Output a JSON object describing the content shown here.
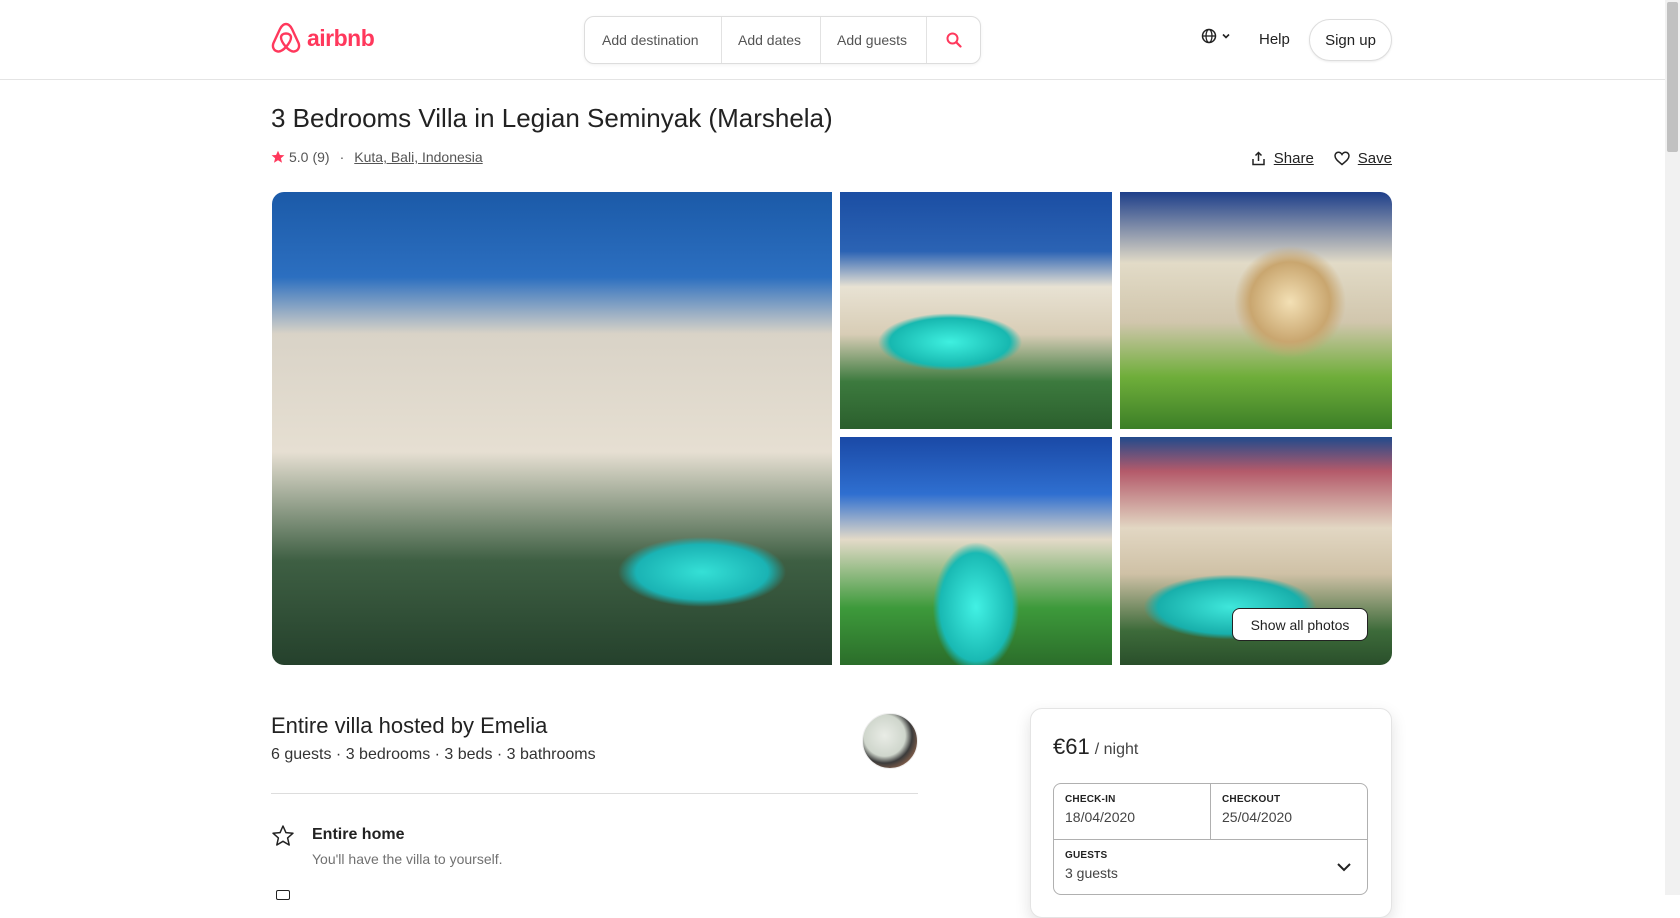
{
  "brand": {
    "name": "airbnb",
    "color": "#ff385c"
  },
  "search": {
    "destination_placeholder": "Add destination",
    "dates_placeholder": "Add dates",
    "guests_placeholder": "Add guests"
  },
  "nav": {
    "language_icon": "globe-icon",
    "help_label": "Help",
    "signup_label": "Sign up"
  },
  "listing": {
    "title": "3 Bedrooms Villa in Legian Seminyak (Marshela)",
    "rating": "5.0",
    "reviews": "(9)",
    "separator": "·",
    "location": "Kuta, Bali, Indonesia",
    "share_label": "Share",
    "save_label": "Save",
    "show_all_photos_label": "Show all photos"
  },
  "host": {
    "title": "Entire villa hosted by Emelia",
    "summary": "6 guests · 3 bedrooms · 3 beds · 3 bathrooms"
  },
  "features": [
    {
      "icon": "star-outline-icon",
      "title": "Entire home",
      "description": "You'll have the villa to yourself."
    }
  ],
  "booking": {
    "price": "€61",
    "price_unit": "/ night",
    "checkin_label": "CHECK-IN",
    "checkin_value": "18/04/2020",
    "checkout_label": "CHECKOUT",
    "checkout_value": "25/04/2020",
    "guests_label": "GUESTS",
    "guests_value": "3 guests"
  }
}
